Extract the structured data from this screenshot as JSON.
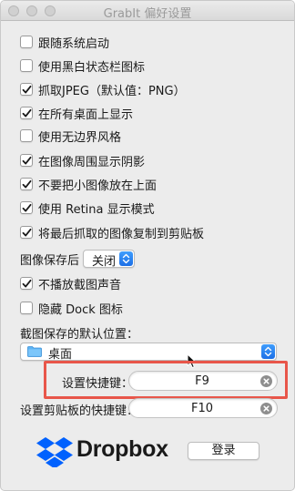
{
  "window": {
    "title": "GrabIt 偏好设置"
  },
  "options": [
    {
      "label": "跟随系统启动",
      "checked": false
    },
    {
      "label": "使用黑白状态栏图标",
      "checked": false
    },
    {
      "label": "抓取JPEG（默认值：PNG）",
      "checked": true
    },
    {
      "label": "在所有桌面上显示",
      "checked": true
    },
    {
      "label": "使用无边界风格",
      "checked": false
    },
    {
      "label": "在图像周围显示阴影",
      "checked": true
    },
    {
      "label": "不要把小图像放在上面",
      "checked": true
    },
    {
      "label": "使用 Retina 显示模式",
      "checked": true
    },
    {
      "label": "将最后抓取的图像复制到剪贴板",
      "checked": true
    }
  ],
  "save_after": {
    "label": "图像保存后",
    "value": "关闭"
  },
  "options2": [
    {
      "label": "不播放截图声音",
      "checked": true
    },
    {
      "label": "隐藏 Dock 图标",
      "checked": false
    }
  ],
  "save_location": {
    "label": "截图保存的默认位置：",
    "value": "桌面"
  },
  "hotkeys": {
    "capture_label": "设置快捷键：",
    "capture_value": "F9",
    "clipboard_label": "设置剪贴板的快捷键：",
    "clipboard_value": "F10"
  },
  "dropbox": {
    "brand": "Dropbox",
    "login_label": "登录",
    "brand_color": "#0061fe"
  },
  "colors": {
    "accent": "#1c6fe6",
    "highlight_border": "#e8564a",
    "checkmark": "#1a1a1a"
  }
}
